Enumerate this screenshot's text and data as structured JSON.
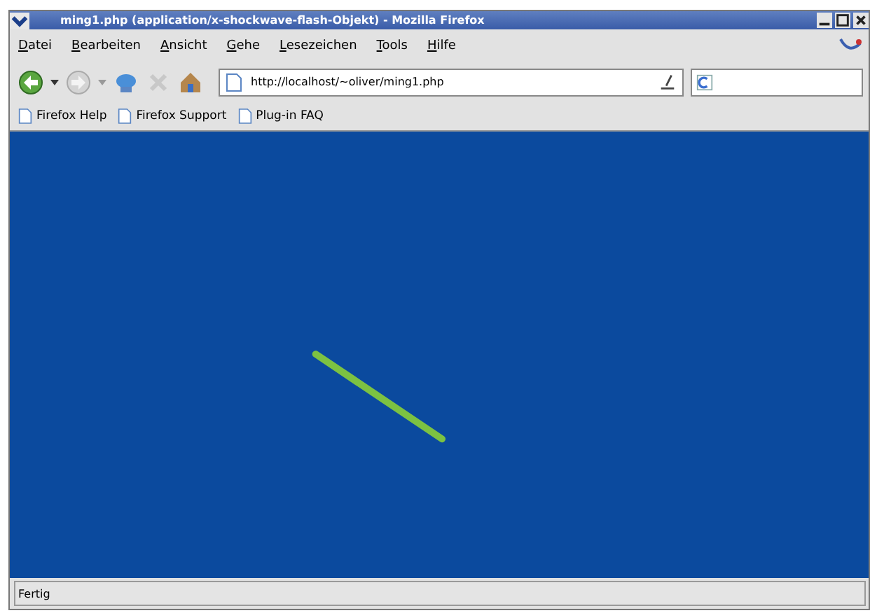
{
  "window": {
    "title": "ming1.php (application/x-shockwave-flash-Objekt) - Mozilla Firefox"
  },
  "menu": [
    "Datei",
    "Bearbeiten",
    "Ansicht",
    "Gehe",
    "Lesezeichen",
    "Tools",
    "Hilfe"
  ],
  "address": {
    "value": "http://localhost/~oliver/ming1.php"
  },
  "bookmarks": [
    "Firefox Help",
    "Firefox Support",
    "Plug-in FAQ"
  ],
  "status_bar": "Fertig"
}
